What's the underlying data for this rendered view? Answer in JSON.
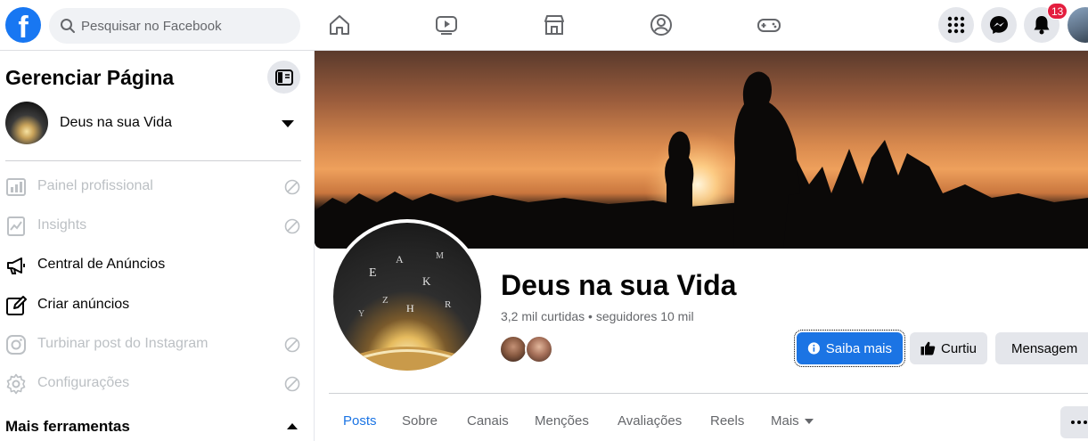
{
  "topbar": {
    "logo_letter": "f",
    "search_placeholder": "Pesquisar no Facebook",
    "nav_icons": [
      "home-icon",
      "watch-icon",
      "marketplace-icon",
      "groups-icon",
      "gaming-icon"
    ],
    "right_icons": [
      "menu-grid-icon",
      "messenger-icon",
      "notifications-icon"
    ],
    "notification_count": "13",
    "brand_color": "#1877f2"
  },
  "sidebar": {
    "title": "Gerenciar Página",
    "page_name": "Deus na sua Vida",
    "items": [
      {
        "label": "Painel profissional",
        "icon": "dashboard-icon",
        "enabled": false
      },
      {
        "label": "Insights",
        "icon": "insights-icon",
        "enabled": false
      },
      {
        "label": "Central de Anúncios",
        "icon": "megaphone-icon",
        "enabled": true
      },
      {
        "label": "Criar anúncios",
        "icon": "pencil-icon",
        "enabled": true
      },
      {
        "label": "Turbinar post do Instagram",
        "icon": "instagram-icon",
        "enabled": false
      },
      {
        "label": "Configurações",
        "icon": "gear-icon",
        "enabled": false
      }
    ],
    "section_partial": "Mais ferramentas"
  },
  "page": {
    "name": "Deus na sua Vida",
    "stats": "3,2 mil curtidas • seguidores 10 mil",
    "buttons": {
      "learn_more": "Saiba mais",
      "liked": "Curtiu",
      "message": "Mensagem"
    },
    "tabs": [
      "Posts",
      "Sobre",
      "Canais",
      "Menções",
      "Avaliações",
      "Reels",
      "Mais"
    ],
    "active_tab": "Posts",
    "accent_color": "#1b74e4"
  }
}
